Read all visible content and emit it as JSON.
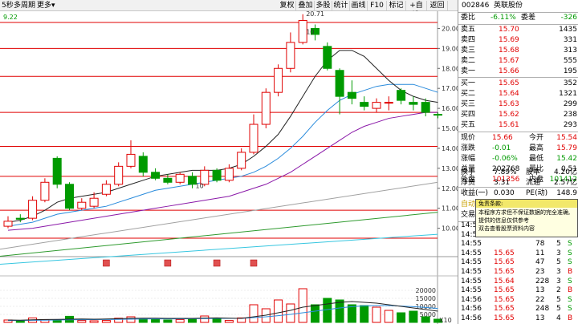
{
  "toolbar": {
    "timeframe": "5秒",
    "multi_period": "多周期",
    "more": "更多",
    "buttons": [
      "复权",
      "叠加",
      "多股",
      "统计",
      "画线",
      "F10",
      "标记",
      "+自选",
      "返回"
    ],
    "price_readout": "9.22"
  },
  "chart_data": {
    "type": "candlestick",
    "price_axis": {
      "ylim": [
        8.9,
        20.7
      ],
      "ticks": [
        10.0,
        11.0,
        12.0,
        13.0,
        14.0,
        15.0,
        16.0,
        17.0,
        18.0,
        19.0,
        20.0
      ]
    },
    "candles": [
      {
        "o": 10.1,
        "c": 10.35,
        "h": 10.6,
        "l": 10.0
      },
      {
        "o": 10.5,
        "c": 10.45,
        "h": 10.7,
        "l": 10.3
      },
      {
        "o": 10.5,
        "c": 11.4,
        "h": 11.6,
        "l": 10.4
      },
      {
        "o": 11.4,
        "c": 12.3,
        "h": 12.5,
        "l": 11.3
      },
      {
        "o": 13.5,
        "c": 12.2,
        "h": 13.6,
        "l": 12.0
      },
      {
        "o": 12.2,
        "c": 11.0,
        "h": 12.3,
        "l": 10.9
      },
      {
        "o": 11.0,
        "c": 11.3,
        "h": 11.5,
        "l": 10.9
      },
      {
        "o": 11.1,
        "c": 11.5,
        "h": 11.8,
        "l": 11.0
      },
      {
        "o": 11.7,
        "c": 12.2,
        "h": 12.4,
        "l": 11.6
      },
      {
        "o": 12.2,
        "c": 13.1,
        "h": 13.3,
        "l": 12.1
      },
      {
        "o": 13.1,
        "c": 13.7,
        "h": 14.4,
        "l": 13.0
      },
      {
        "o": 13.6,
        "c": 12.8,
        "h": 13.8,
        "l": 12.6
      },
      {
        "o": 12.8,
        "c": 12.5,
        "h": 13.0,
        "l": 12.4
      },
      {
        "o": 12.5,
        "c": 12.3,
        "h": 12.7,
        "l": 12.2
      },
      {
        "o": 12.3,
        "c": 12.7,
        "h": 12.8,
        "l": 12.2
      },
      {
        "o": 12.6,
        "c": 12.2,
        "h": 12.8,
        "l": 12.0
      },
      {
        "o": 12.2,
        "c": 12.9,
        "h": 13.1,
        "l": 12.1
      },
      {
        "o": 12.9,
        "c": 12.4,
        "h": 13.0,
        "l": 12.3
      },
      {
        "o": 12.4,
        "c": 13.0,
        "h": 13.2,
        "l": 12.3
      },
      {
        "o": 13.0,
        "c": 13.8,
        "h": 14.0,
        "l": 12.9
      },
      {
        "o": 13.8,
        "c": 15.2,
        "h": 15.7,
        "l": 13.7
      },
      {
        "o": 15.2,
        "c": 16.8,
        "h": 17.0,
        "l": 15.0
      },
      {
        "o": 16.8,
        "c": 18.0,
        "h": 18.2,
        "l": 16.6
      },
      {
        "o": 18.0,
        "c": 19.3,
        "h": 19.8,
        "l": 17.8
      },
      {
        "o": 19.3,
        "c": 20.4,
        "h": 20.71,
        "l": 19.2
      },
      {
        "o": 20.0,
        "c": 19.7,
        "h": 20.2,
        "l": 19.4
      },
      {
        "o": 19.1,
        "c": 18.0,
        "h": 19.3,
        "l": 17.9
      },
      {
        "o": 17.9,
        "c": 16.6,
        "h": 18.0,
        "l": 15.7
      },
      {
        "o": 16.8,
        "c": 16.5,
        "h": 17.4,
        "l": 16.2
      },
      {
        "o": 16.3,
        "c": 16.1,
        "h": 16.6,
        "l": 15.9
      },
      {
        "o": 16.0,
        "c": 16.3,
        "h": 16.5,
        "l": 15.8
      },
      {
        "o": 16.3,
        "c": 16.3,
        "h": 16.6,
        "l": 15.9
      },
      {
        "o": 16.9,
        "c": 16.4,
        "h": 17.0,
        "l": 16.2
      },
      {
        "o": 16.3,
        "c": 16.2,
        "h": 16.6,
        "l": 15.9
      },
      {
        "o": 16.3,
        "c": 15.8,
        "h": 16.5,
        "l": 15.6
      },
      {
        "o": 15.7,
        "c": 15.66,
        "h": 15.8,
        "l": 15.5
      }
    ],
    "ma_black": [
      10.3,
      10.4,
      10.6,
      10.9,
      11.3,
      11.5,
      11.6,
      11.7,
      11.8,
      12.0,
      12.2,
      12.4,
      12.6,
      12.7,
      12.8,
      12.9,
      12.9,
      12.9,
      13.0,
      13.2,
      13.6,
      14.1,
      14.7,
      15.6,
      16.6,
      17.6,
      18.4,
      18.9,
      18.9,
      18.6,
      18.0,
      17.4,
      16.9,
      16.6,
      16.4,
      16.3
    ],
    "ma_blue": [
      10.1,
      10.2,
      10.3,
      10.5,
      10.7,
      10.8,
      10.9,
      11.0,
      11.1,
      11.3,
      11.5,
      11.7,
      11.9,
      12.0,
      12.1,
      12.2,
      12.3,
      12.4,
      12.5,
      12.6,
      12.8,
      13.1,
      13.5,
      14.0,
      14.6,
      15.3,
      15.9,
      16.4,
      16.7,
      16.9,
      17.1,
      17.2,
      17.2,
      17.2,
      17.0,
      16.8
    ],
    "ma_purple": [
      9.9,
      9.95,
      10.0,
      10.1,
      10.2,
      10.3,
      10.4,
      10.5,
      10.6,
      10.7,
      10.8,
      10.9,
      11.0,
      11.1,
      11.2,
      11.3,
      11.4,
      11.5,
      11.6,
      11.8,
      12.0,
      12.2,
      12.5,
      12.8,
      13.2,
      13.6,
      14.0,
      14.4,
      14.8,
      15.1,
      15.3,
      15.5,
      15.6,
      15.7,
      15.8,
      15.8
    ],
    "ma_gray": {
      "start": 8.95,
      "end": 12.3
    },
    "ma_green": {
      "start": 8.6,
      "end": 10.8
    },
    "ma_cyan": {
      "start": 8.2,
      "end": 9.7
    },
    "red_levels": [
      20.3,
      19.0,
      17.6,
      15.8,
      14.1,
      12.6,
      10.9,
      9.5
    ],
    "annotations": [
      {
        "text": "20.71",
        "idx": 24,
        "price": 20.71
      },
      {
        "text": "10",
        "idx": 24,
        "price": 19.8
      },
      {
        "text": "10",
        "idx": 15,
        "price": 12.1
      }
    ],
    "volume_axis": {
      "ylim": [
        0,
        22000
      ],
      "ticks": [
        5000,
        10000,
        15000,
        20000
      ],
      "unit_label": "X10"
    },
    "volumes": [
      1500,
      1000,
      2800,
      1500,
      1200,
      3800,
      1200,
      1000,
      1200,
      2600,
      3500,
      2500,
      2000,
      1500,
      1800,
      2000,
      4000,
      2500,
      1200,
      2800,
      11000,
      8500,
      14000,
      11500,
      21000,
      11000,
      15000,
      14000,
      11000,
      10500,
      9500,
      7500,
      6000,
      7000,
      3500,
      2000
    ],
    "vol_ma_black": [
      1500,
      1400,
      1600,
      1800,
      1900,
      2000,
      2100,
      2000,
      2100,
      2300,
      2500,
      2600,
      2600,
      2500,
      2500,
      2500,
      2700,
      2800,
      2600,
      2500,
      3500,
      4500,
      6000,
      7500,
      9500,
      10500,
      11500,
      12500,
      13000,
      12500,
      12000,
      11000,
      10000,
      9000,
      8000,
      7000
    ],
    "vol_ma_blue": [
      1200,
      1250,
      1300,
      1400,
      1500,
      1600,
      1700,
      1750,
      1800,
      1900,
      2000,
      2100,
      2200,
      2200,
      2200,
      2300,
      2400,
      2500,
      2500,
      2500,
      3000,
      3500,
      4200,
      5000,
      6000,
      7000,
      8000,
      9000,
      9800,
      10300,
      10500,
      10500,
      10200,
      9800,
      9300,
      8700
    ],
    "event_markers": [
      8,
      13,
      17,
      20
    ]
  },
  "panel": {
    "code": "002846",
    "name": "英联股份",
    "weibi_label": "委比",
    "weibi_value": "-6.11%",
    "weicha_label": "委差",
    "weicha_value": "-326",
    "asks": [
      {
        "label": "卖五",
        "price": "15.70",
        "vol": "1435"
      },
      {
        "label": "卖四",
        "price": "15.69",
        "vol": "331"
      },
      {
        "label": "卖三",
        "price": "15.68",
        "vol": "313"
      },
      {
        "label": "卖二",
        "price": "15.67",
        "vol": "555"
      },
      {
        "label": "卖一",
        "price": "15.66",
        "vol": "195"
      }
    ],
    "bids": [
      {
        "label": "买一",
        "price": "15.65",
        "vol": "352"
      },
      {
        "label": "买二",
        "price": "15.64",
        "vol": "1321"
      },
      {
        "label": "买三",
        "price": "15.63",
        "vol": "299"
      },
      {
        "label": "买四",
        "price": "15.62",
        "vol": "238"
      },
      {
        "label": "买五",
        "price": "15.61",
        "vol": "293"
      }
    ],
    "stats": [
      {
        "l1": "现价",
        "v1": "15.66",
        "l2": "今开",
        "v2": "15.54",
        "c1": "red",
        "c2": "red"
      },
      {
        "l1": "涨跌",
        "v1": "-0.01",
        "l2": "最高",
        "v2": "15.79",
        "c1": "green",
        "c2": "red"
      },
      {
        "l1": "涨幅",
        "v1": "-0.06%",
        "l2": "最低",
        "v2": "15.42",
        "c1": "green",
        "c2": "green"
      },
      {
        "l1": "总量",
        "v1": "202768",
        "l2": "量比",
        "v2": "0.51",
        "c1": "blk",
        "c2": "blk"
      },
      {
        "l1": "外盘",
        "v1": "101356",
        "l2": "内盘",
        "v2": "101412",
        "c1": "red",
        "c2": "green"
      }
    ],
    "stats2": [
      {
        "l1": "换手",
        "v1": "7.89%",
        "l2": "股本",
        "v2": "4.20亿"
      },
      {
        "l1": "净资",
        "v1": "3.31",
        "l2": "流通",
        "v2": "2.57亿"
      },
      {
        "l1": "收益(一)",
        "v1": "0.030",
        "l2": "PE(动)",
        "v2": "148.9"
      }
    ],
    "section_label": "自动",
    "trade_label": "交易",
    "trades": [
      {
        "time": "14:55",
        "price": "",
        "vol": "",
        "count": "",
        "side": ""
      },
      {
        "time": "14:55",
        "price": "",
        "vol": "",
        "count": "",
        "side": ""
      },
      {
        "time": "14:55",
        "price": "",
        "vol": "78",
        "count": "5",
        "side": "S"
      },
      {
        "time": "14:55",
        "price": "15.65",
        "vol": "11",
        "count": "3",
        "side": "S"
      },
      {
        "time": "14:55",
        "price": "15.65",
        "vol": "47",
        "count": "5",
        "side": "S"
      },
      {
        "time": "14:55",
        "price": "15.65",
        "vol": "23",
        "count": "3",
        "side": "B"
      },
      {
        "time": "14:55",
        "price": "15.64",
        "vol": "228",
        "count": "3",
        "side": "S"
      },
      {
        "time": "14:55",
        "price": "15.65",
        "vol": "13",
        "count": "2",
        "side": "B"
      },
      {
        "time": "14:56",
        "price": "15.65",
        "vol": "22",
        "count": "5",
        "side": "S"
      },
      {
        "time": "14:56",
        "price": "15.65",
        "vol": "248",
        "count": "5",
        "side": "S"
      },
      {
        "time": "14:56",
        "price": "15.65",
        "vol": "13",
        "count": "4",
        "side": "B"
      }
    ]
  },
  "popup": {
    "title": "免责条款:",
    "lines": [
      "本程序方求但不保证数据的完全准确,",
      "提供的信息仅供参考",
      "双击查看股票资料内容"
    ]
  },
  "colors": {
    "up": "#e00000",
    "down": "#009a00",
    "level_line": "#e00000",
    "ma_black": "#222222",
    "ma_blue": "#2a8bdc",
    "ma_purple": "#8a18a8"
  }
}
